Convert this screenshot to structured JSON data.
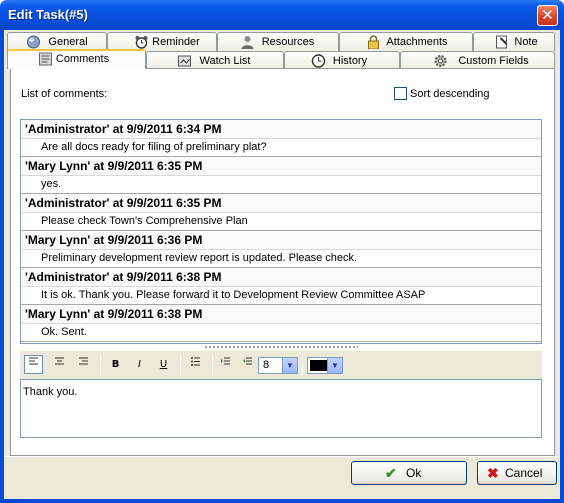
{
  "window": {
    "title": "Edit Task(#5)",
    "close_glyph": "✕"
  },
  "tabs_row1": [
    {
      "label": "General",
      "icon": "globe-icon"
    },
    {
      "label": "Reminder",
      "icon": "alarm-clock-icon"
    },
    {
      "label": "Resources",
      "icon": "person-icon"
    },
    {
      "label": "Attachments",
      "icon": "lock-icon"
    },
    {
      "label": "Note",
      "icon": "note-icon"
    }
  ],
  "tabs_row2": [
    {
      "label": "Comments",
      "icon": "comments-icon",
      "active": true
    },
    {
      "label": "Watch List",
      "icon": "watch-list-icon"
    },
    {
      "label": "History",
      "icon": "history-icon"
    },
    {
      "label": "Custom Fields",
      "icon": "gear-icon"
    }
  ],
  "comments_panel": {
    "list_label": "List of comments:",
    "sort_label": "Sort descending",
    "sort_checked": false
  },
  "comments": [
    {
      "author_line": "'Administrator' at 9/9/2011 6:34 PM",
      "text": "Are all docs ready for filing of preliminary plat?"
    },
    {
      "author_line": "'Mary Lynn' at 9/9/2011 6:35 PM",
      "text": "yes."
    },
    {
      "author_line": "'Administrator' at 9/9/2011 6:35 PM",
      "text": "Please check Town's Comprehensive Plan"
    },
    {
      "author_line": "'Mary Lynn' at 9/9/2011 6:36 PM",
      "text": "Preliminary development review report is updated. Please check."
    },
    {
      "author_line": "'Administrator' at 9/9/2011 6:38 PM",
      "text": "It is ok. Thank you. Please forward it to Development Review Committee ASAP"
    },
    {
      "author_line": "'Mary Lynn' at 9/9/2011 6:38 PM",
      "text": "Ok. Sent."
    }
  ],
  "toolbar": {
    "font_size": "8",
    "text_color": "#000000",
    "bold": "B",
    "italic": "I",
    "underline": "U"
  },
  "editor": {
    "value": "Thank you."
  },
  "buttons": {
    "ok_label": "Ok",
    "cancel_label": "Cancel"
  },
  "colors": {
    "title_bar": "#0a4fdc",
    "active_tab_highlight": "#ffc83c",
    "ok_check": "#2a9a1f",
    "cancel_x": "#cc1a1a"
  }
}
